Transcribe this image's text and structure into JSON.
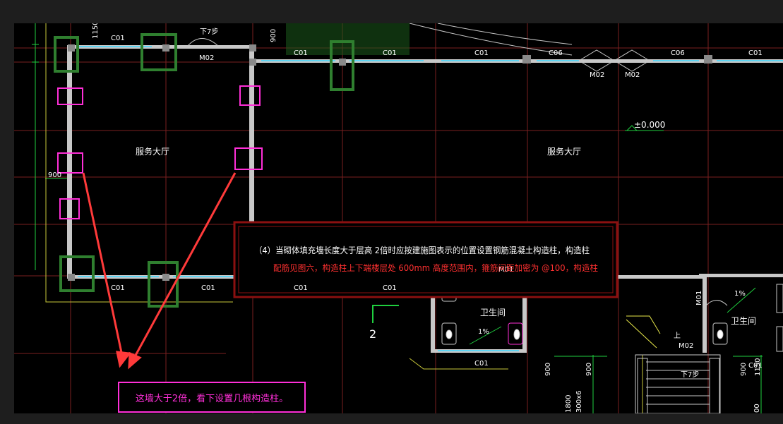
{
  "labels": {
    "room_left": "服务大厅",
    "room_right": "服务大厅",
    "toilet_1": "卫生间",
    "toilet_2": "卫生间",
    "elevation": "±0.000",
    "section_mark": "2",
    "stair_up_1": "上",
    "stair_steps_1": "下7步",
    "stair_steps_2": "下7步"
  },
  "windows": {
    "c01": "C01",
    "c06": "C06"
  },
  "doors": {
    "m01": "M01",
    "m02": "M02"
  },
  "dimensions": {
    "d1150": "1150",
    "d900": "900",
    "d1800": "1800",
    "d300x6": "300x6",
    "d00": "00",
    "slope": "1%"
  },
  "note": {
    "line1": "（4）当砌体填充墙长度大于层高 2倍时应按建施图表示的位置设置钢筋混凝土构造柱，构造柱",
    "line2": "配筋见图六，构造柱上下端楼层处 600mm 高度范围内，箍筋间距加密为 @100，构造柱"
  },
  "callout": {
    "text": "这墙大于2倍，看下设置几根构造柱。"
  },
  "colors": {
    "wall": "#c8c8c8",
    "axis": "#d23b3b",
    "green_box": "#2f7f2f",
    "magenta_box": "#ff2fd8",
    "window_cyan": "#3ad7ff",
    "note_box": "#8b1010",
    "arrow": "#ff3a3a",
    "grid_green": "#1fcf3f",
    "yellow": "#e8e84a"
  }
}
